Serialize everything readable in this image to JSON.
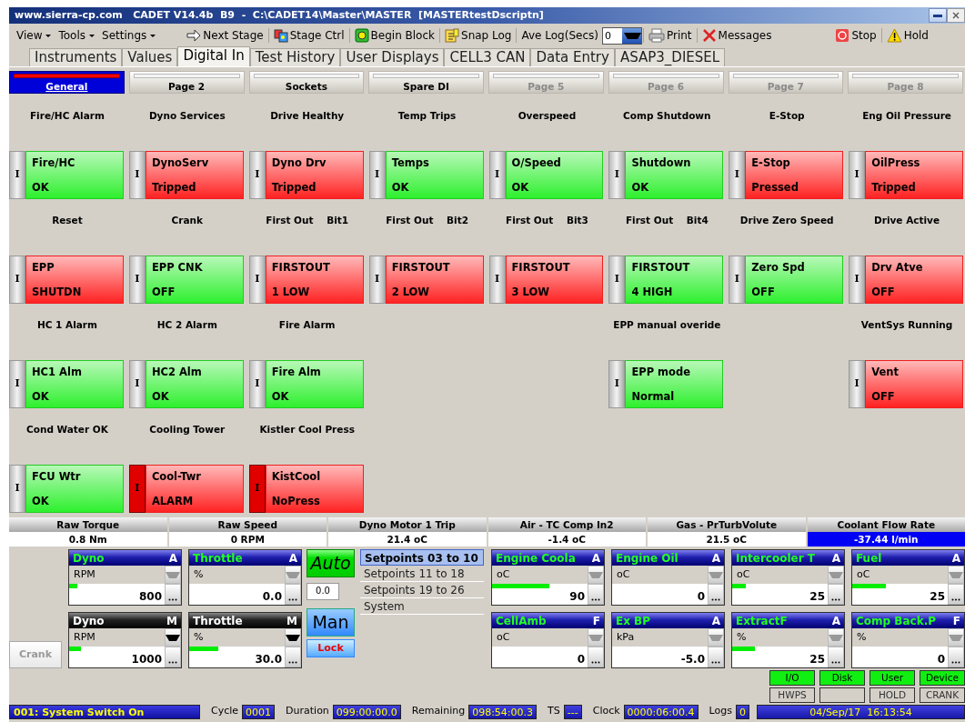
{
  "window": {
    "title": "www.sierra-cp.com   CADET V14.4b  B9  -  C:\\CADET14\\Master\\MASTER  [MASTERtestDscriptn]"
  },
  "menus": [
    "View",
    "Tools",
    "Settings"
  ],
  "toolbar": [
    {
      "kind": "next",
      "label": "Next Stage"
    },
    {
      "kind": "stage",
      "label": "Stage Ctrl"
    },
    {
      "kind": "block",
      "label": "Begin Block"
    },
    {
      "kind": "snap",
      "label": "Snap Log"
    },
    {
      "kind": "combo",
      "label": "Ave Log(Secs)",
      "value": "0"
    },
    {
      "kind": "print",
      "label": "Print"
    },
    {
      "kind": "messages",
      "label": "Messages"
    },
    {
      "kind": "stop",
      "label": "Stop"
    },
    {
      "kind": "hold",
      "label": "Hold"
    }
  ],
  "tabs": [
    {
      "label": "Instruments",
      "selected": false
    },
    {
      "label": "Values",
      "selected": false
    },
    {
      "label": "Digital In",
      "selected": true
    },
    {
      "label": "Test History",
      "selected": false
    },
    {
      "label": "User Displays",
      "selected": false
    },
    {
      "label": "CELL3 CAN",
      "selected": false
    },
    {
      "label": "Data Entry",
      "selected": false
    },
    {
      "label": "ASAP3_DIESEL",
      "selected": false
    }
  ],
  "pages": [
    {
      "label": "General",
      "selected": true,
      "disabled": false
    },
    {
      "label": "Page 2",
      "selected": false,
      "disabled": false
    },
    {
      "label": "Sockets",
      "selected": false,
      "disabled": false
    },
    {
      "label": "Spare DI",
      "selected": false,
      "disabled": false
    },
    {
      "label": "Page 5",
      "selected": false,
      "disabled": true
    },
    {
      "label": "Page 6",
      "selected": false,
      "disabled": true
    },
    {
      "label": "Page 7",
      "selected": false,
      "disabled": true
    },
    {
      "label": "Page 8",
      "selected": false,
      "disabled": true
    }
  ],
  "signal_rows": [
    {
      "cells": [
        {
          "kind": "signal",
          "label": "Fire/HC Alarm",
          "indicator": "I",
          "name": "Fire/HC",
          "status": "OK",
          "alarm": false,
          "latched": false
        },
        {
          "kind": "signal",
          "label": "Dyno Services",
          "indicator": "I",
          "name": "DynoServ",
          "status": "Tripped",
          "alarm": true,
          "latched": false
        },
        {
          "kind": "signal",
          "label": "Drive Healthy",
          "indicator": "I",
          "name": "Dyno Drv",
          "status": "Tripped",
          "alarm": true,
          "latched": false
        },
        {
          "kind": "signal",
          "label": "Temp Trips",
          "indicator": "I",
          "name": "Temps",
          "status": "OK",
          "alarm": false,
          "latched": false
        },
        {
          "kind": "signal",
          "label": "Overspeed",
          "indicator": "I",
          "name": "O/Speed",
          "status": "OK",
          "alarm": false,
          "latched": false
        },
        {
          "kind": "signal",
          "label": "Comp Shutdown",
          "indicator": "I",
          "name": "Shutdown",
          "status": "OK",
          "alarm": false,
          "latched": false
        },
        {
          "kind": "signal",
          "label": "E-Stop",
          "indicator": "I",
          "name": "E-Stop",
          "status": "Pressed",
          "alarm": true,
          "latched": false
        },
        {
          "kind": "signal",
          "label": "Eng Oil Pressure",
          "indicator": "I",
          "name": "OilPress",
          "status": "Tripped",
          "alarm": true,
          "latched": false
        }
      ]
    },
    {
      "cells": [
        {
          "kind": "signal",
          "label": "Reset",
          "indicator": "I",
          "name": "EPP",
          "status": "SHUTDN",
          "alarm": true,
          "latched": false
        },
        {
          "kind": "signal",
          "label": "Crank",
          "indicator": "I",
          "name": "EPP CNK",
          "status": "OFF",
          "alarm": false,
          "latched": false
        },
        {
          "kind": "signal",
          "label": "First Out    Bit1",
          "indicator": "I",
          "name": "FIRSTOUT",
          "status": "1 LOW",
          "alarm": true,
          "latched": false
        },
        {
          "kind": "signal",
          "label": "First Out    Bit2",
          "indicator": "I",
          "name": "FIRSTOUT",
          "status": "2 LOW",
          "alarm": true,
          "latched": false
        },
        {
          "kind": "signal",
          "label": "First Out    Bit3",
          "indicator": "I",
          "name": "FIRSTOUT",
          "status": "3 LOW",
          "alarm": true,
          "latched": false
        },
        {
          "kind": "signal",
          "label": "First Out    Bit4",
          "indicator": "I",
          "name": "FIRSTOUT",
          "status": "4 HIGH",
          "alarm": false,
          "latched": false
        },
        {
          "kind": "signal",
          "label": "Drive Zero Speed",
          "indicator": "I",
          "name": "Zero Spd",
          "status": "OFF",
          "alarm": false,
          "latched": false
        },
        {
          "kind": "signal",
          "label": "Drive Active",
          "indicator": "I",
          "name": "Drv Atve",
          "status": "OFF",
          "alarm": true,
          "latched": false
        }
      ]
    },
    {
      "cells": [
        {
          "kind": "signal",
          "label": "HC 1 Alarm",
          "indicator": "I",
          "name": "HC1 Alm",
          "status": "OK",
          "alarm": false,
          "latched": false
        },
        {
          "kind": "signal",
          "label": "HC 2 Alarm",
          "indicator": "I",
          "name": "HC2 Alm",
          "status": "OK",
          "alarm": false,
          "latched": false
        },
        {
          "kind": "signal",
          "label": "Fire Alarm",
          "indicator": "I",
          "name": "Fire Alm",
          "status": "OK",
          "alarm": false,
          "latched": false
        },
        {
          "kind": "empty"
        },
        {
          "kind": "empty"
        },
        {
          "kind": "signal",
          "label": "EPP manual overide",
          "indicator": "I",
          "name": "EPP mode",
          "status": "Normal",
          "alarm": false,
          "latched": false
        },
        {
          "kind": "empty"
        },
        {
          "kind": "signal",
          "label": "VentSys Running",
          "indicator": "I",
          "name": "Vent",
          "status": "OFF",
          "alarm": true,
          "latched": false
        }
      ]
    },
    {
      "cells": [
        {
          "kind": "signal",
          "label": "Cond Water OK",
          "indicator": "I",
          "name": "FCU Wtr",
          "status": "OK",
          "alarm": false,
          "latched": false
        },
        {
          "kind": "signal",
          "label": "Cooling Tower",
          "indicator": "I",
          "name": "Cool-Twr",
          "status": "ALARM",
          "alarm": true,
          "latched": true
        },
        {
          "kind": "signal",
          "label": "Kistler Cool Press",
          "indicator": "I",
          "name": "KistCool",
          "status": "NoPress",
          "alarm": true,
          "latched": true
        },
        {
          "kind": "empty"
        },
        {
          "kind": "empty"
        },
        {
          "kind": "empty"
        },
        {
          "kind": "empty"
        },
        {
          "kind": "empty"
        }
      ]
    }
  ],
  "readouts": [
    {
      "label": "Raw Torque",
      "value": "0.8 Nm",
      "highlight": false
    },
    {
      "label": "Raw Speed",
      "value": "0 RPM",
      "highlight": false
    },
    {
      "label": "Dyno Motor 1 Trip",
      "value": "21.4 oC",
      "highlight": false
    },
    {
      "label": "Air - TC Comp In2",
      "value": "-1.4 oC",
      "highlight": false
    },
    {
      "label": "Gas - PrTurbVolute",
      "value": "21.5 oC",
      "highlight": false
    },
    {
      "label": "Coolant Flow Rate",
      "value": "-37.44 l/min",
      "highlight": true
    }
  ],
  "crank": {
    "label": "Crank",
    "disabled": true
  },
  "demands": [
    {
      "kind": "auto",
      "title": "Dyno",
      "mode": "A",
      "unit": "RPM",
      "value": "800",
      "level": 0.09
    },
    {
      "kind": "auto",
      "title": "Throttle",
      "mode": "A",
      "unit": "%",
      "value": "0.0"
    },
    {
      "kind": "manual",
      "title": "Dyno",
      "mode": "M",
      "unit": "RPM",
      "value": "1000",
      "level": 0.12
    },
    {
      "kind": "manual",
      "title": "Throttle",
      "mode": "M",
      "unit": "%",
      "value": "30.0",
      "level": 0.3
    }
  ],
  "auto_button": {
    "label": "Auto",
    "selected": true
  },
  "ramp_value": "0.0",
  "man_button": {
    "label": "Man",
    "selected": false
  },
  "lock_button": {
    "label": "Lock"
  },
  "setpoint_pages": [
    {
      "label": "Setpoints 03 to 10",
      "selected": true
    },
    {
      "label": "Setpoints 11 to 18",
      "selected": false
    },
    {
      "label": "Setpoints 19 to 26",
      "selected": false
    },
    {
      "label": "System",
      "selected": false
    }
  ],
  "channels": [
    {
      "title": "Engine Coola",
      "mode": "A",
      "unit": "oC",
      "value": "90",
      "level": 0.6
    },
    {
      "title": "Engine Oil",
      "mode": "A",
      "unit": "oC",
      "value": "0"
    },
    {
      "title": "Intercooler T",
      "mode": "A",
      "unit": "oC",
      "value": "25",
      "level": 0.14
    },
    {
      "title": "Fuel",
      "mode": "A",
      "unit": "oC",
      "value": "25",
      "level": 0.35
    },
    {
      "title": "CellAmb",
      "mode": "F",
      "unit": "oC",
      "value": "0"
    },
    {
      "title": "Ex BP",
      "mode": "A",
      "unit": "kPa",
      "value": "-5.0"
    },
    {
      "title": "ExtractF",
      "mode": "A",
      "unit": "%",
      "value": "25",
      "level": 0.24
    },
    {
      "title": "Comp Back.P",
      "mode": "F",
      "unit": "%",
      "value": "0"
    }
  ],
  "status_indicators": [
    {
      "label": "I/O",
      "on": true
    },
    {
      "label": "Disk",
      "on": true
    },
    {
      "label": "User",
      "on": true
    },
    {
      "label": "Device",
      "on": true
    },
    {
      "label": "HWPS",
      "on": false
    },
    {
      "on": false
    },
    {
      "label": "HOLD",
      "on": false
    },
    {
      "label": "CRANK",
      "on": false
    }
  ],
  "status_bar": {
    "message": "001: System Switch On",
    "fields": [
      {
        "label": "Cycle",
        "value": "0001"
      },
      {
        "label": "Duration",
        "value": "099:00:00.0"
      },
      {
        "label": "Remaining",
        "value": "098:54:00.3"
      },
      {
        "label": "TS",
        "value": "---"
      },
      {
        "label": "Clock",
        "value": "0000:06:00.4"
      },
      {
        "label": "Logs",
        "value": "0"
      }
    ],
    "datetime": "04/Sep/17  16:13:54"
  }
}
